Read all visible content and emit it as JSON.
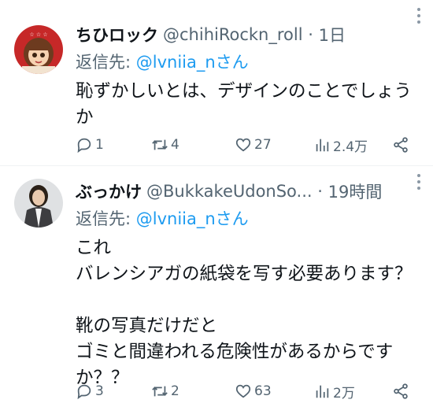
{
  "tweets": [
    {
      "display_name": "ちひロック",
      "handle": "@chihiRockn_roll",
      "time": "1日",
      "reply_prefix": "返信先: ",
      "reply_mention": "@lvniia_nさん",
      "text": "恥ずかしいとは、デザインのことでしょうか",
      "replies": "1",
      "retweets": "4",
      "likes": "27",
      "views": "2.4万"
    },
    {
      "display_name": "ぶっかけ",
      "handle": "@BukkakeUdonSo...",
      "time": "19時間",
      "reply_prefix": "返信先: ",
      "reply_mention": "@lvniia_nさん",
      "text": "これ\nバレンシアガの紙袋を写す必要あります？\n\n靴の写真だけだと\nゴミと間違われる危険性があるからですか？？",
      "replies": "3",
      "retweets": "2",
      "likes": "63",
      "views": "2万"
    }
  ],
  "colors": {
    "accent": "#1d9bf0",
    "secondary_text": "#536471",
    "primary_text": "#0f1419",
    "divider": "#eff3f4"
  },
  "icons": [
    "reply-icon",
    "retweet-icon",
    "heart-icon",
    "views-icon",
    "share-icon",
    "more-icon"
  ]
}
